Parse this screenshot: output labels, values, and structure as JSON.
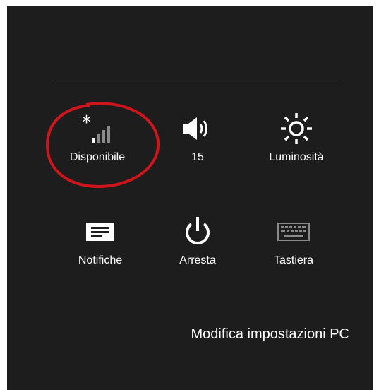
{
  "charms": {
    "row1": [
      {
        "label": "Disponibile",
        "icon": "network-available-icon"
      },
      {
        "label": "15",
        "icon": "volume-icon"
      },
      {
        "label": "Luminosità",
        "icon": "brightness-icon"
      }
    ],
    "row2": [
      {
        "label": "Notifiche",
        "icon": "notifications-icon"
      },
      {
        "label": "Arresta",
        "icon": "power-icon"
      },
      {
        "label": "Tastiera",
        "icon": "keyboard-icon"
      }
    ],
    "settings_link": "Modifica impostazioni PC"
  },
  "colors": {
    "panel_bg": "#1d1d1d",
    "text": "#ffffff",
    "icon_dim": "#8a8a8a",
    "annotation": "#d0141b"
  }
}
